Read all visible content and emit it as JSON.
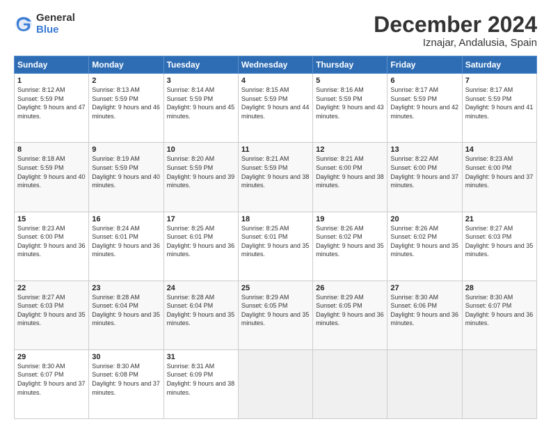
{
  "header": {
    "logo_general": "General",
    "logo_blue": "Blue",
    "month": "December 2024",
    "location": "Iznajar, Andalusia, Spain"
  },
  "weekdays": [
    "Sunday",
    "Monday",
    "Tuesday",
    "Wednesday",
    "Thursday",
    "Friday",
    "Saturday"
  ],
  "weeks": [
    [
      {
        "day": "1",
        "sunrise": "8:12 AM",
        "sunset": "5:59 PM",
        "daylight": "9 hours and 47 minutes."
      },
      {
        "day": "2",
        "sunrise": "8:13 AM",
        "sunset": "5:59 PM",
        "daylight": "9 hours and 46 minutes."
      },
      {
        "day": "3",
        "sunrise": "8:14 AM",
        "sunset": "5:59 PM",
        "daylight": "9 hours and 45 minutes."
      },
      {
        "day": "4",
        "sunrise": "8:15 AM",
        "sunset": "5:59 PM",
        "daylight": "9 hours and 44 minutes."
      },
      {
        "day": "5",
        "sunrise": "8:16 AM",
        "sunset": "5:59 PM",
        "daylight": "9 hours and 43 minutes."
      },
      {
        "day": "6",
        "sunrise": "8:17 AM",
        "sunset": "5:59 PM",
        "daylight": "9 hours and 42 minutes."
      },
      {
        "day": "7",
        "sunrise": "8:17 AM",
        "sunset": "5:59 PM",
        "daylight": "9 hours and 41 minutes."
      }
    ],
    [
      {
        "day": "8",
        "sunrise": "8:18 AM",
        "sunset": "5:59 PM",
        "daylight": "9 hours and 40 minutes."
      },
      {
        "day": "9",
        "sunrise": "8:19 AM",
        "sunset": "5:59 PM",
        "daylight": "9 hours and 40 minutes."
      },
      {
        "day": "10",
        "sunrise": "8:20 AM",
        "sunset": "5:59 PM",
        "daylight": "9 hours and 39 minutes."
      },
      {
        "day": "11",
        "sunrise": "8:21 AM",
        "sunset": "5:59 PM",
        "daylight": "9 hours and 38 minutes."
      },
      {
        "day": "12",
        "sunrise": "8:21 AM",
        "sunset": "6:00 PM",
        "daylight": "9 hours and 38 minutes."
      },
      {
        "day": "13",
        "sunrise": "8:22 AM",
        "sunset": "6:00 PM",
        "daylight": "9 hours and 37 minutes."
      },
      {
        "day": "14",
        "sunrise": "8:23 AM",
        "sunset": "6:00 PM",
        "daylight": "9 hours and 37 minutes."
      }
    ],
    [
      {
        "day": "15",
        "sunrise": "8:23 AM",
        "sunset": "6:00 PM",
        "daylight": "9 hours and 36 minutes."
      },
      {
        "day": "16",
        "sunrise": "8:24 AM",
        "sunset": "6:01 PM",
        "daylight": "9 hours and 36 minutes."
      },
      {
        "day": "17",
        "sunrise": "8:25 AM",
        "sunset": "6:01 PM",
        "daylight": "9 hours and 36 minutes."
      },
      {
        "day": "18",
        "sunrise": "8:25 AM",
        "sunset": "6:01 PM",
        "daylight": "9 hours and 35 minutes."
      },
      {
        "day": "19",
        "sunrise": "8:26 AM",
        "sunset": "6:02 PM",
        "daylight": "9 hours and 35 minutes."
      },
      {
        "day": "20",
        "sunrise": "8:26 AM",
        "sunset": "6:02 PM",
        "daylight": "9 hours and 35 minutes."
      },
      {
        "day": "21",
        "sunrise": "8:27 AM",
        "sunset": "6:03 PM",
        "daylight": "9 hours and 35 minutes."
      }
    ],
    [
      {
        "day": "22",
        "sunrise": "8:27 AM",
        "sunset": "6:03 PM",
        "daylight": "9 hours and 35 minutes."
      },
      {
        "day": "23",
        "sunrise": "8:28 AM",
        "sunset": "6:04 PM",
        "daylight": "9 hours and 35 minutes."
      },
      {
        "day": "24",
        "sunrise": "8:28 AM",
        "sunset": "6:04 PM",
        "daylight": "9 hours and 35 minutes."
      },
      {
        "day": "25",
        "sunrise": "8:29 AM",
        "sunset": "6:05 PM",
        "daylight": "9 hours and 35 minutes."
      },
      {
        "day": "26",
        "sunrise": "8:29 AM",
        "sunset": "6:05 PM",
        "daylight": "9 hours and 36 minutes."
      },
      {
        "day": "27",
        "sunrise": "8:30 AM",
        "sunset": "6:06 PM",
        "daylight": "9 hours and 36 minutes."
      },
      {
        "day": "28",
        "sunrise": "8:30 AM",
        "sunset": "6:07 PM",
        "daylight": "9 hours and 36 minutes."
      }
    ],
    [
      {
        "day": "29",
        "sunrise": "8:30 AM",
        "sunset": "6:07 PM",
        "daylight": "9 hours and 37 minutes."
      },
      {
        "day": "30",
        "sunrise": "8:30 AM",
        "sunset": "6:08 PM",
        "daylight": "9 hours and 37 minutes."
      },
      {
        "day": "31",
        "sunrise": "8:31 AM",
        "sunset": "6:09 PM",
        "daylight": "9 hours and 38 minutes."
      },
      null,
      null,
      null,
      null
    ]
  ]
}
